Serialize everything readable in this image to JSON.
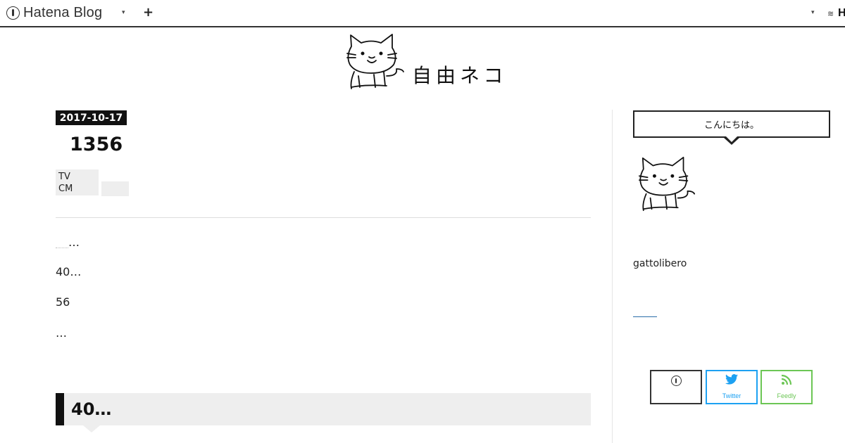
{
  "topbar": {
    "brand": "Hatena Blog",
    "plus_icon": "+",
    "right_text": "H"
  },
  "header": {
    "logo_text": "自由ネコ"
  },
  "article": {
    "date": "2017-10-17",
    "title": "1356",
    "category_tag": "TV\nCM",
    "paragraphs": [
      "…",
      "40…",
      "56",
      "…"
    ],
    "section_heading": "40…"
  },
  "sidebar": {
    "greeting": "こんにちは。",
    "username": "gattolibero",
    "subscribe_buttons": [
      {
        "label": "",
        "icon": "hatena-icon",
        "color": "#333333"
      },
      {
        "label": "Twitter",
        "icon": "twitter-icon",
        "color": "#1da1f2"
      },
      {
        "label": "Feedly",
        "icon": "feedly-icon",
        "color": "#6cc655"
      }
    ]
  },
  "colors": {
    "accent_dark": "#111111",
    "tag_bg": "#eeeeee"
  }
}
